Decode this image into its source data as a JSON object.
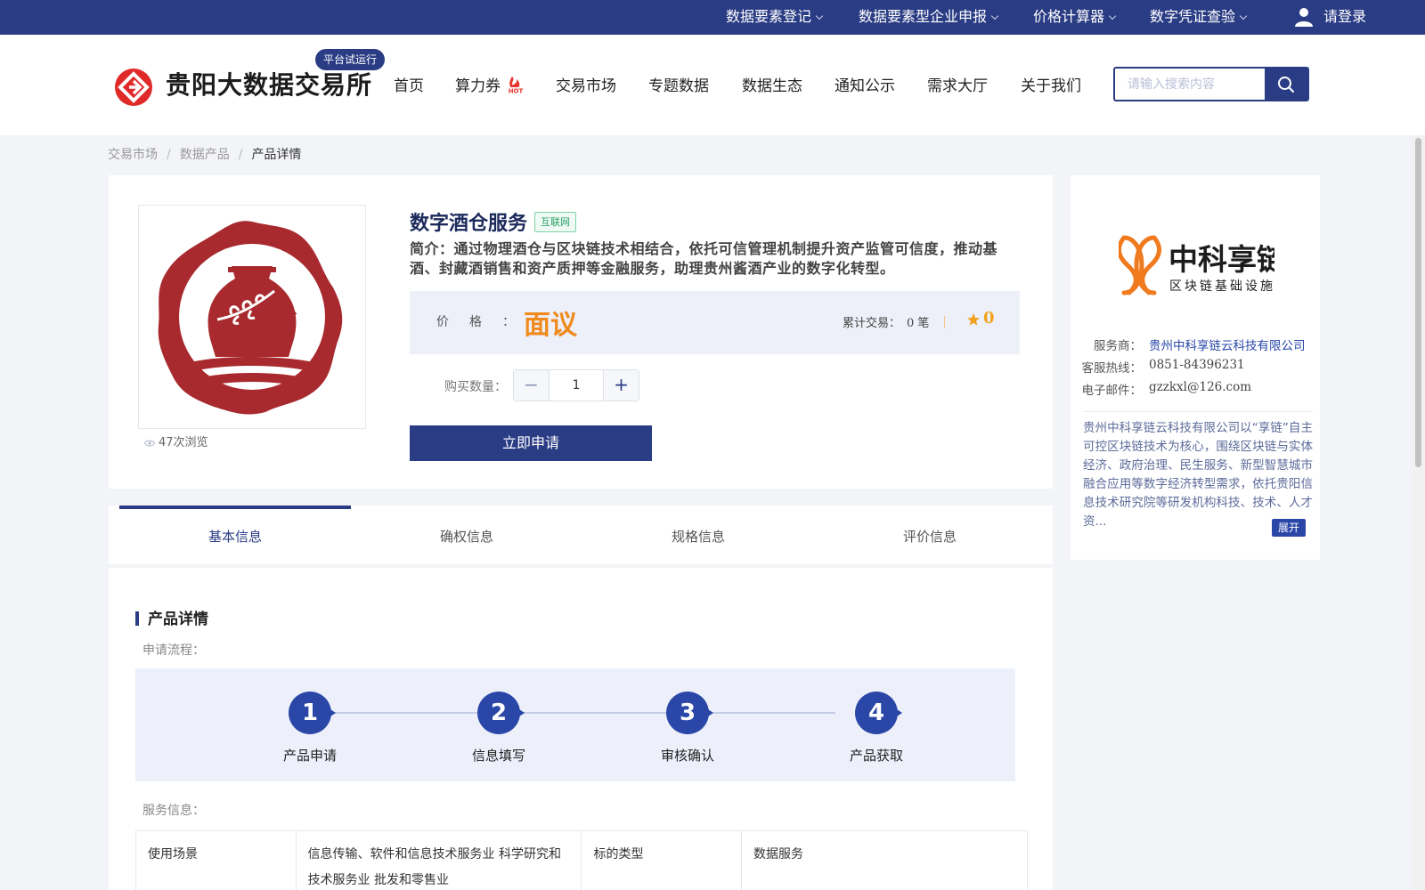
{
  "topbar": {
    "items": [
      "数据要素登记",
      "数据要素型企业申报",
      "价格计算器",
      "数字凭证查验"
    ],
    "login": "请登录"
  },
  "header": {
    "site_title": "贵阳大数据交易所",
    "trial_badge": "平台试运行",
    "nav": [
      "首页",
      "算力券",
      "交易市场",
      "专题数据",
      "数据生态",
      "通知公示",
      "需求大厅",
      "关于我们"
    ],
    "hot_badge_icon": "hot-flame-icon",
    "search_placeholder": "请输入搜索内容",
    "brand_color": "#2a3c84"
  },
  "breadcrumb": [
    "交易市场",
    "数据产品",
    "产品详情"
  ],
  "product": {
    "title": "数字酒仓服务",
    "tag": "互联网",
    "description": "简介：通过物理酒仓与区块链技术相结合，依托可信管理机制提升资产监管可信度，推动基酒、封藏酒销售和资产质押等金融服务，助理贵州酱酒产业的数字化转型。",
    "views": "47次浏览",
    "price_label": "价格：",
    "price_value": "面议",
    "trade_label": "累计交易：",
    "trade_value": "0 笔",
    "rating": "0",
    "qty_label": "购买数量：",
    "qty_value": "1",
    "apply_button": "立即申请"
  },
  "tabs": [
    "基本信息",
    "确权信息",
    "规格信息",
    "评价信息"
  ],
  "detail": {
    "section_title": "产品详情",
    "flow_label": "申请流程：",
    "steps": [
      {
        "num": "1",
        "name": "产品申请"
      },
      {
        "num": "2",
        "name": "信息填写"
      },
      {
        "num": "3",
        "name": "审核确认"
      },
      {
        "num": "4",
        "name": "产品获取"
      }
    ],
    "service_label": "服务信息：",
    "table": [
      [
        "使用场景",
        "信息传输、软件和信息技术服务业 科学研究和技术服务业 批发和零售业",
        "标的类型",
        "数据服务"
      ]
    ]
  },
  "vendor": {
    "logo_text": "中科享链",
    "logo_subtext": "区块链基础设施",
    "provider_label": "服务商：",
    "provider_value": "贵州中科享链云科技有限公司",
    "hotline_label": "客服热线：",
    "hotline_value": "0851-84396231",
    "email_label": "电子邮件：",
    "email_value": "gzzkxl@126.com",
    "description": "贵州中科享链云科技有限公司以“享链”自主可控区块链技术为核心，围绕区块链与实体经济、政府治理、民生服务、新型智慧城市融合应用等数字经济转型需求，依托贵阳信息技术研究院等研发机构科技、技术、人才资...",
    "expand": "展开"
  }
}
